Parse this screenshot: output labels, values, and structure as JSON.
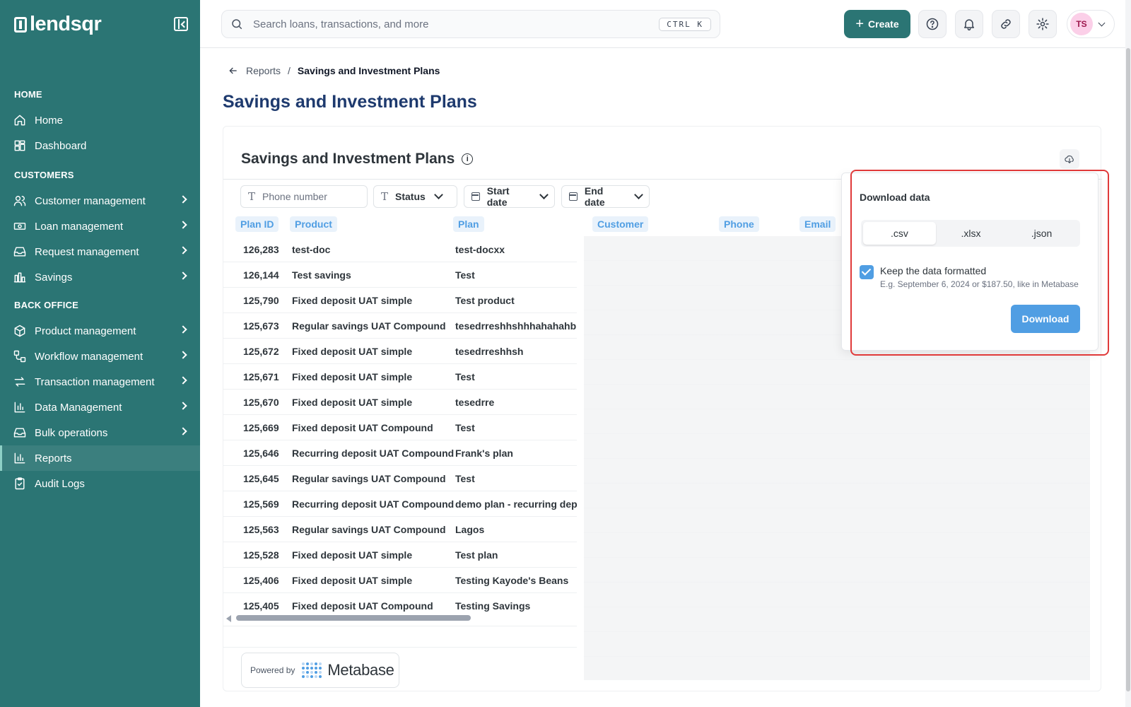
{
  "app": {
    "logo_text": "lendsqr"
  },
  "sidebar": {
    "sections": [
      {
        "label": "HOME",
        "items": [
          {
            "label": "Home",
            "icon": "home-icon",
            "chevron": false
          },
          {
            "label": "Dashboard",
            "icon": "dashboard-icon",
            "chevron": false
          }
        ]
      },
      {
        "label": "CUSTOMERS",
        "items": [
          {
            "label": "Customer management",
            "icon": "users-icon",
            "chevron": true
          },
          {
            "label": "Loan management",
            "icon": "banknote-icon",
            "chevron": true
          },
          {
            "label": "Request management",
            "icon": "inbox-icon",
            "chevron": true
          },
          {
            "label": "Savings",
            "icon": "piggy-bank-icon",
            "chevron": true
          }
        ]
      },
      {
        "label": "BACK OFFICE",
        "items": [
          {
            "label": "Product management",
            "icon": "package-icon",
            "chevron": true
          },
          {
            "label": "Workflow management",
            "icon": "workflow-icon",
            "chevron": true
          },
          {
            "label": "Transaction management",
            "icon": "arrows-exchange-icon",
            "chevron": true
          },
          {
            "label": "Data Management",
            "icon": "bar-chart-icon",
            "chevron": true
          },
          {
            "label": "Bulk operations",
            "icon": "inbox-icon",
            "chevron": true
          },
          {
            "label": "Reports",
            "icon": "bar-chart-icon",
            "chevron": false,
            "active": true
          },
          {
            "label": "Audit Logs",
            "icon": "clipboard-check-icon",
            "chevron": false
          }
        ]
      }
    ]
  },
  "topbar": {
    "search_placeholder": "Search loans, transactions, and more",
    "shortcut": "CTRL K",
    "create_label": "Create",
    "avatar_initials": "TS"
  },
  "breadcrumb": {
    "parent": "Reports",
    "separator": "/",
    "current": "Savings and Investment Plans"
  },
  "page": {
    "title": "Savings and Investment Plans"
  },
  "card": {
    "title": "Savings and Investment Plans",
    "filters": {
      "phone_placeholder": "Phone number",
      "status": "Status",
      "start_date": "Start date",
      "end_date": "End date"
    },
    "columns": [
      "Plan ID",
      "Product",
      "Plan",
      "Customer",
      "Phone",
      "Email"
    ],
    "rows": [
      [
        "126,283",
        "test-doc",
        "test-docxx"
      ],
      [
        "126,144",
        "Test savings",
        "Test"
      ],
      [
        "125,790",
        "Fixed deposit UAT simple",
        "Test product"
      ],
      [
        "125,673",
        "Regular savings UAT Compound",
        "tesedrreshhshhhahahahbbb"
      ],
      [
        "125,672",
        "Fixed deposit UAT simple",
        "tesedrreshhsh"
      ],
      [
        "125,671",
        "Fixed deposit UAT simple",
        "Test"
      ],
      [
        "125,670",
        "Fixed deposit UAT simple",
        "tesedrre"
      ],
      [
        "125,669",
        "Fixed deposit UAT Compound",
        "Test"
      ],
      [
        "125,646",
        "Recurring deposit UAT Compound",
        "Frank's plan"
      ],
      [
        "125,645",
        "Regular savings UAT Compound",
        "Test"
      ],
      [
        "125,569",
        "Recurring deposit UAT Compound",
        "demo plan - recurring dep"
      ],
      [
        "125,563",
        "Regular savings UAT Compound",
        "Lagos"
      ],
      [
        "125,528",
        "Fixed deposit UAT simple",
        "Test plan"
      ],
      [
        "125,406",
        "Fixed deposit UAT simple",
        "Testing Kayode's Beans"
      ],
      [
        "125,405",
        "Fixed deposit UAT Compound",
        "Testing Savings"
      ]
    ],
    "powered_by": "Powered by",
    "metabase_name": "Metabase"
  },
  "download_popover": {
    "title": "Download data",
    "formats": [
      ".csv",
      ".xlsx",
      ".json"
    ],
    "selected_format": ".csv",
    "keep_formatted_label": "Keep the data formatted",
    "keep_formatted_checked": true,
    "keep_formatted_hint": "E.g. September 6, 2024 or $187.50, like in Metabase",
    "download_label": "Download"
  },
  "colors": {
    "sidebar": "#2b7574",
    "accent": "#509ee3",
    "title": "#1e3a6e",
    "highlight": "#e03a3a"
  }
}
